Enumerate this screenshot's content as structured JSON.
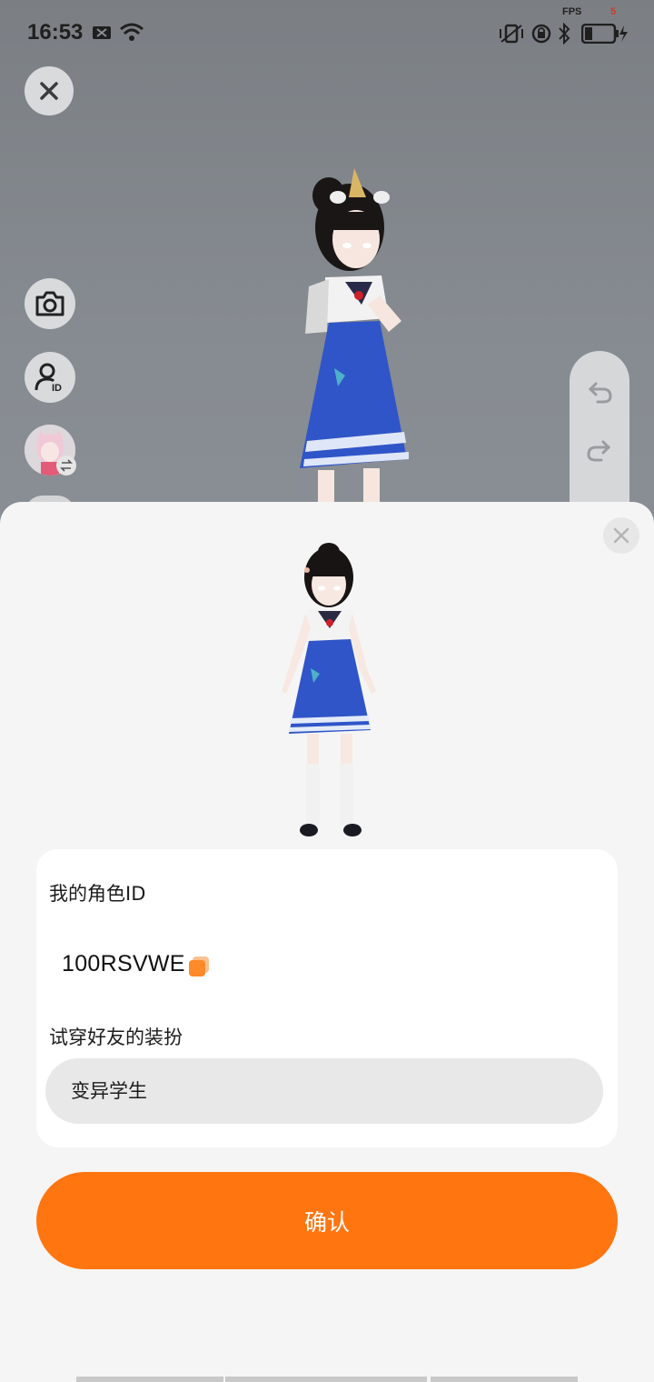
{
  "status_bar": {
    "time": "16:53",
    "fps_label": "FPS",
    "fps_value": "5"
  },
  "scene": {
    "close_icon": "close-icon",
    "camera_icon": "camera-icon",
    "id_icon": "user-id-icon",
    "swap_icon": "swap-icon",
    "undo_icon": "undo-icon",
    "redo_icon": "redo-icon"
  },
  "sheet": {
    "role_id_label": "我的角色ID",
    "role_id_value": "100RSVWE",
    "try_outfit_label": "试穿好友的装扮",
    "outfit_input_value": "变异学生",
    "confirm_label": "确认"
  },
  "colors": {
    "accent": "#ff7510",
    "sheet_bg": "#f5f5f5",
    "card_bg": "#ffffff",
    "input_bg": "#e8e8e8",
    "dress": "#2f55c8"
  }
}
